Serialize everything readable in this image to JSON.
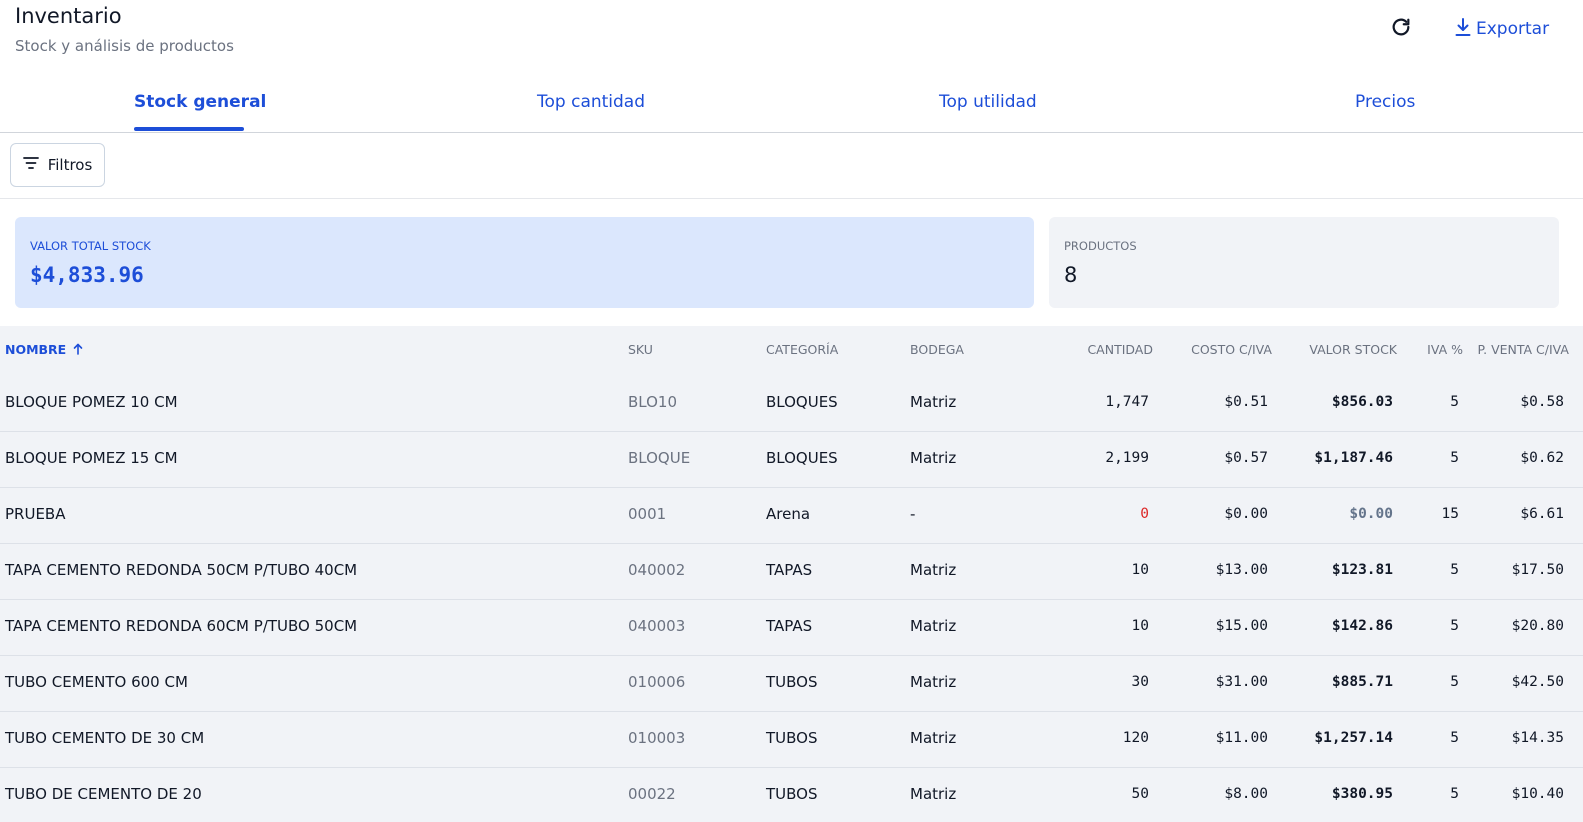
{
  "header": {
    "title": "Inventario",
    "subtitle": "Stock y análisis de productos",
    "export_label": "Exportar",
    "refresh_icon": "refresh-icon",
    "export_icon": "download-icon"
  },
  "tabs": [
    {
      "label": "Stock general",
      "active": true
    },
    {
      "label": "Top cantidad",
      "active": false
    },
    {
      "label": "Top utilidad",
      "active": false
    },
    {
      "label": "Precios",
      "active": false
    }
  ],
  "toolbar": {
    "filters_label": "Filtros",
    "filters_icon": "filter-lines-icon"
  },
  "summary": {
    "total_label": "VALOR TOTAL STOCK",
    "total_value": "$4,833.96",
    "products_label": "PRODUCTOS",
    "products_value": "8"
  },
  "table": {
    "columns": {
      "nombre": "NOMBRE",
      "sku": "SKU",
      "categoria": "CATEGORÍA",
      "bodega": "BODEGA",
      "cantidad": "CANTIDAD",
      "costo": "COSTO C/IVA",
      "valor": "VALOR STOCK",
      "iva": "IVA %",
      "pventa": "P. VENTA C/IVA"
    },
    "sort": {
      "column": "nombre",
      "direction": "ascending",
      "icon": "arrow-up-icon"
    },
    "rows": [
      {
        "nombre": "BLOQUE POMEZ 10 CM",
        "sku": "BLO10",
        "categoria": "BLOQUES",
        "bodega": "Matriz",
        "cantidad": "1,747",
        "costo": "$0.51",
        "valor": "$856.03",
        "iva": "5",
        "pventa": "$0.58"
      },
      {
        "nombre": "BLOQUE POMEZ 15 CM",
        "sku": "BLOQUE",
        "categoria": "BLOQUES",
        "bodega": "Matriz",
        "cantidad": "2,199",
        "costo": "$0.57",
        "valor": "$1,187.46",
        "iva": "5",
        "pventa": "$0.62"
      },
      {
        "nombre": "PRUEBA",
        "sku": "0001",
        "categoria": "Arena",
        "bodega": "-",
        "cantidad": "0",
        "costo": "$0.00",
        "valor": "$0.00",
        "iva": "15",
        "pventa": "$6.61"
      },
      {
        "nombre": "TAPA CEMENTO REDONDA 50CM P/TUBO 40CM",
        "sku": "040002",
        "categoria": "TAPAS",
        "bodega": "Matriz",
        "cantidad": "10",
        "costo": "$13.00",
        "valor": "$123.81",
        "iva": "5",
        "pventa": "$17.50"
      },
      {
        "nombre": "TAPA CEMENTO REDONDA 60CM P/TUBO 50CM",
        "sku": "040003",
        "categoria": "TAPAS",
        "bodega": "Matriz",
        "cantidad": "10",
        "costo": "$15.00",
        "valor": "$142.86",
        "iva": "5",
        "pventa": "$20.80"
      },
      {
        "nombre": "TUBO CEMENTO 600 CM",
        "sku": "010006",
        "categoria": "TUBOS",
        "bodega": "Matriz",
        "cantidad": "30",
        "costo": "$31.00",
        "valor": "$885.71",
        "iva": "5",
        "pventa": "$42.50"
      },
      {
        "nombre": "TUBO CEMENTO DE 30 CM",
        "sku": "010003",
        "categoria": "TUBOS",
        "bodega": "Matriz",
        "cantidad": "120",
        "costo": "$11.00",
        "valor": "$1,257.14",
        "iva": "5",
        "pventa": "$14.35"
      },
      {
        "nombre": "TUBO DE CEMENTO DE 20",
        "sku": "00022",
        "categoria": "TUBOS",
        "bodega": "Matriz",
        "cantidad": "50",
        "costo": "$8.00",
        "valor": "$380.95",
        "iva": "5",
        "pventa": "$10.40"
      }
    ]
  },
  "colors": {
    "accent": "#1d4ed8",
    "total_card_bg": "#dbe7fd",
    "table_bg": "#f1f3f7",
    "zero_quantity": "#dc2626"
  }
}
